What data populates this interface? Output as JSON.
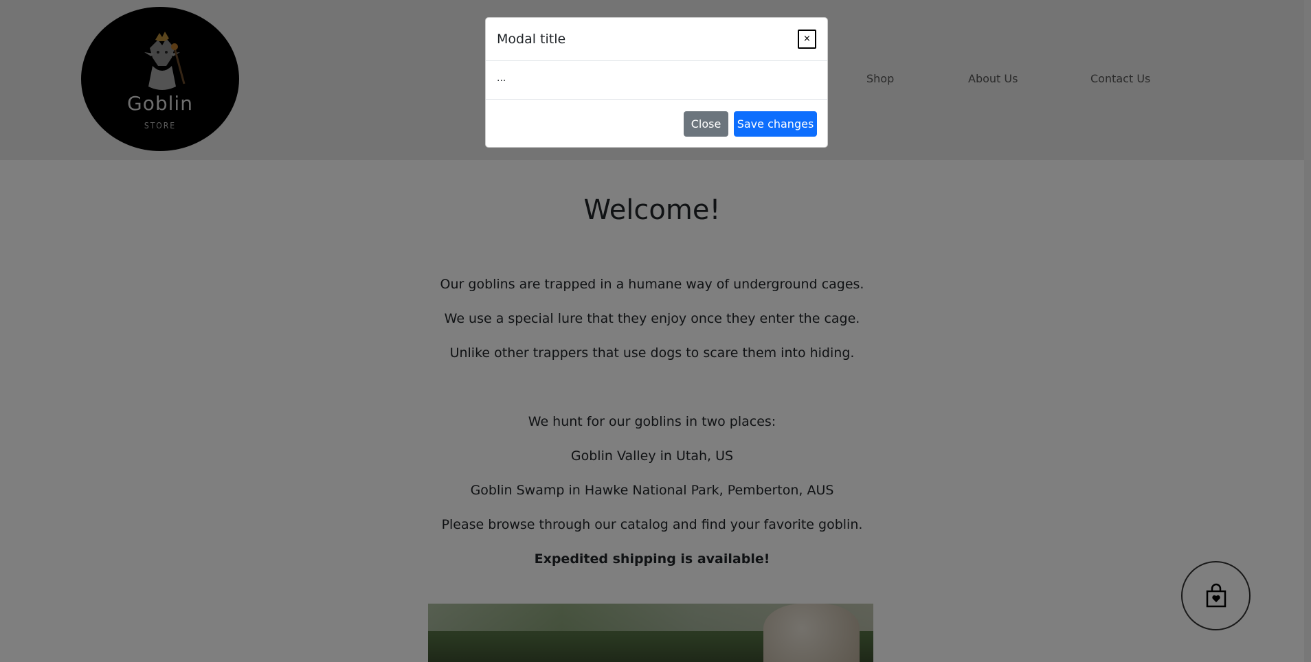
{
  "brand": {
    "name": "Goblin",
    "tagline": "STORE"
  },
  "nav": {
    "items": [
      {
        "label": "Shop"
      },
      {
        "label": "About Us"
      },
      {
        "label": "Contact Us"
      }
    ]
  },
  "main": {
    "heading": "Welcome!",
    "paragraphs": [
      "Our goblins are trapped in a humane way of underground cages.",
      "We use a special lure that they enjoy once they enter the cage.",
      "Unlike other trappers that use dogs to scare them into hiding.",
      "We hunt for our goblins in two places:",
      "Goblin Valley in Utah, US",
      "Goblin Swamp in Hawke National Park, Pemberton, AUS",
      "Please browse through our catalog and find your favorite goblin.",
      "Expedited shipping is available!"
    ]
  },
  "modal": {
    "title": "Modal title",
    "close_x": "×",
    "body": "...",
    "close_label": "Close",
    "save_label": "Save changes"
  },
  "colors": {
    "primary": "#0d6efd",
    "secondary": "#6c757d",
    "backdrop": "rgba(0,0,0,0.5)"
  },
  "icons": {
    "cart": "shopping-bag-heart-icon",
    "logo": "goblin-logo-icon"
  }
}
